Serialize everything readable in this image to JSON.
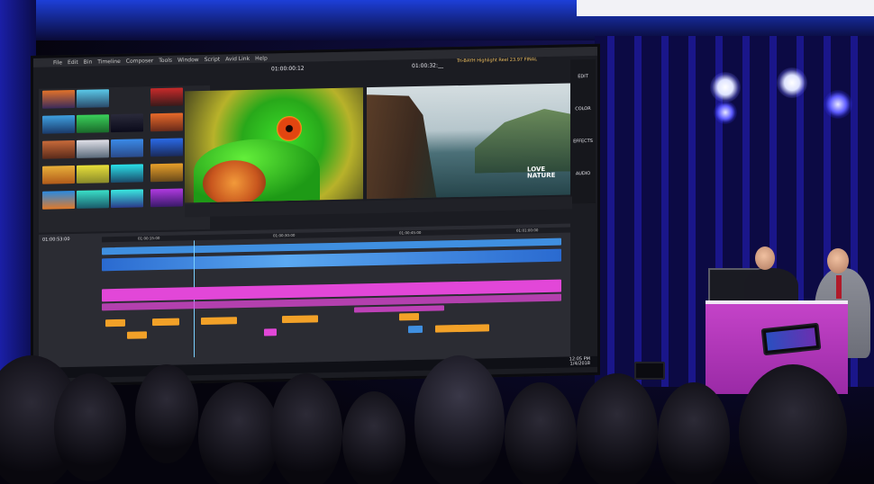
{
  "menu": {
    "items": [
      "File",
      "Edit",
      "Bin",
      "Timeline",
      "Composer",
      "Tools",
      "Window",
      "Script",
      "Avid Link",
      "Help"
    ]
  },
  "viewer": {
    "source_timecode": "01:00:00:12",
    "record_timecode": "01:00:32:__",
    "logo_line1": "LOVE",
    "logo_line2": "NATURE"
  },
  "sequence": {
    "name": "Tri-BAYH Highlight Reel 23.97 FINAL"
  },
  "workspace_tabs": [
    "EDIT",
    "COLOR",
    "EFFECTS",
    "AUDIO"
  ],
  "timeline": {
    "start_timecode": "01:00:53:00",
    "ruler_ticks": [
      "01:00:15:00",
      "01:00:30:00",
      "01:00:45:00",
      "01:01:00:00"
    ]
  },
  "taskbar": {
    "clock_time": "12:05 PM",
    "clock_date": "1/4/2018"
  },
  "colors": {
    "video_track": "#3f8fe0",
    "audio_track": "#e247d8",
    "music_track": "#f2a128",
    "podium": "#c443c8"
  }
}
